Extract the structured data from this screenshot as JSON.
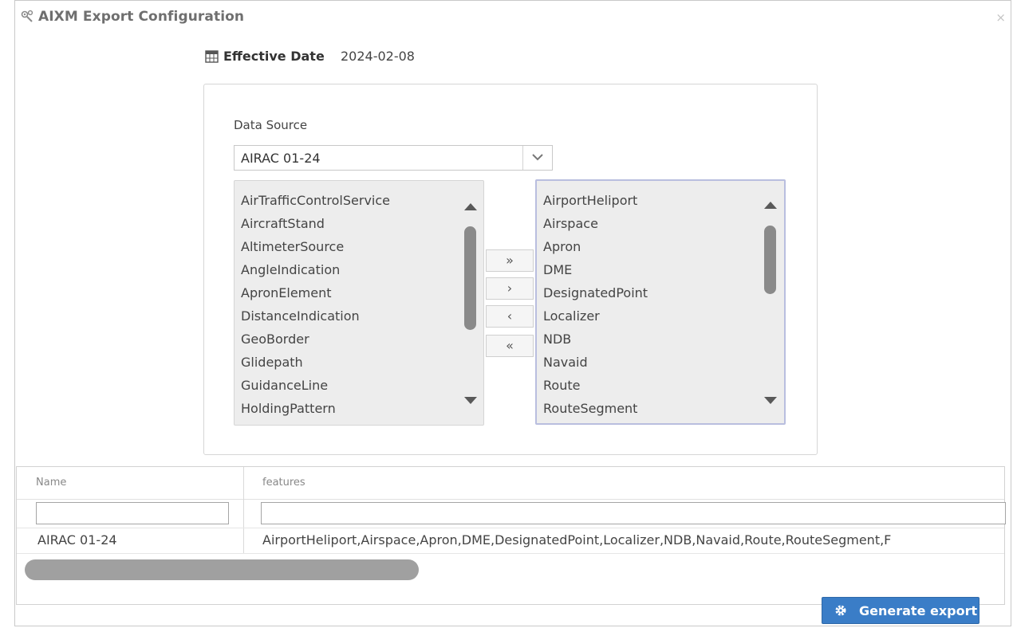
{
  "dialog": {
    "title": "AIXM Export Configuration",
    "close": "×",
    "icon": "wrench-gear-icon"
  },
  "effective_date": {
    "label": "Effective Date",
    "value": "2024-02-08",
    "icon": "calendar-icon"
  },
  "data_source": {
    "label": "Data Source",
    "selected": "AIRAC 01-24"
  },
  "available_features": [
    "AirTrafficControlService",
    "AircraftStand",
    "AltimeterSource",
    "AngleIndication",
    "ApronElement",
    "DistanceIndication",
    "GeoBorder",
    "Glidepath",
    "GuidanceLine",
    "HoldingPattern"
  ],
  "selected_features": [
    "AirportHeliport",
    "Airspace",
    "Apron",
    "DME",
    "DesignatedPoint",
    "Localizer",
    "NDB",
    "Navaid",
    "Route",
    "RouteSegment"
  ],
  "move_buttons": {
    "add_all": "»",
    "add": "›",
    "remove": "‹",
    "remove_all": "«"
  },
  "grid": {
    "columns": [
      "Name",
      "features"
    ],
    "rows": [
      {
        "name": "AIRAC 01-24",
        "features": "AirportHeliport,Airspace,Apron,DME,DesignatedPoint,Localizer,NDB,Navaid,Route,RouteSegment,F"
      }
    ]
  },
  "footer": {
    "generate_label": "Generate export",
    "generate_icon": "gear-icon"
  },
  "colors": {
    "primary_button": "#3a7dc7",
    "selected_list_border": "#b9bedf"
  }
}
